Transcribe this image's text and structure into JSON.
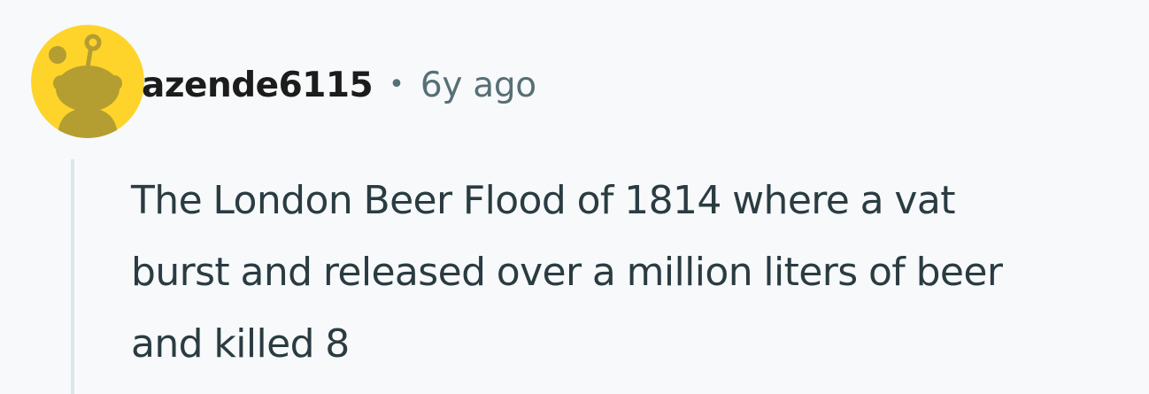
{
  "comment": {
    "author": {
      "username": "azende6115",
      "avatar_icon": "snoo-avatar-icon",
      "avatar_bg": "#fed42a",
      "avatar_fg": "#b49d31"
    },
    "separator": "•",
    "timestamp": "6y ago",
    "body_lines": [
      "The London Beer Flood of 1814 where a vat",
      "burst and released over a million liters of beer",
      "and killed 8"
    ]
  },
  "colors": {
    "background": "#f7f9fa",
    "username": "#1c1c1c",
    "meta": "#576f76",
    "body_text": "#2a3c42",
    "thread_line": "#dde6ea"
  }
}
